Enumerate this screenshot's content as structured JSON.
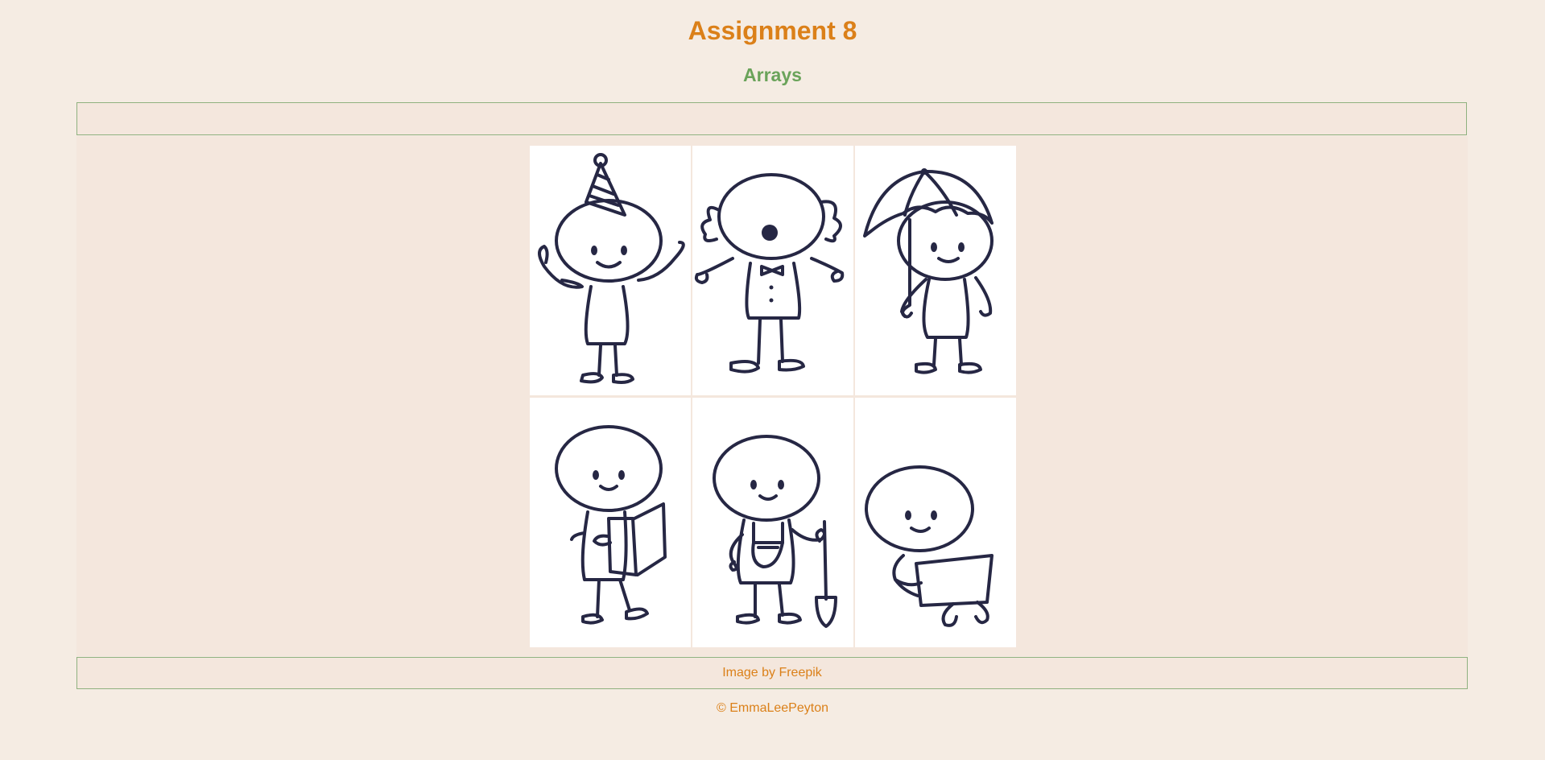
{
  "header": {
    "title": "Assignment 8",
    "subtitle": "Arrays"
  },
  "gallery": {
    "images": [
      {
        "icon": "party-hat-character-icon"
      },
      {
        "icon": "clown-character-icon"
      },
      {
        "icon": "umbrella-character-icon"
      },
      {
        "icon": "reading-character-icon"
      },
      {
        "icon": "gardener-shovel-character-icon"
      },
      {
        "icon": "laptop-character-icon"
      }
    ]
  },
  "footer": {
    "credit_prefix": "Image by ",
    "credit_link": "Freepik",
    "copyright": "© EmmaLeePeyton"
  },
  "colors": {
    "background": "#f5ece3",
    "panel": "#f4e7dd",
    "title": "#db8019",
    "subtitle": "#6aa35a",
    "border": "#8fb17f",
    "ink": "#262744"
  }
}
